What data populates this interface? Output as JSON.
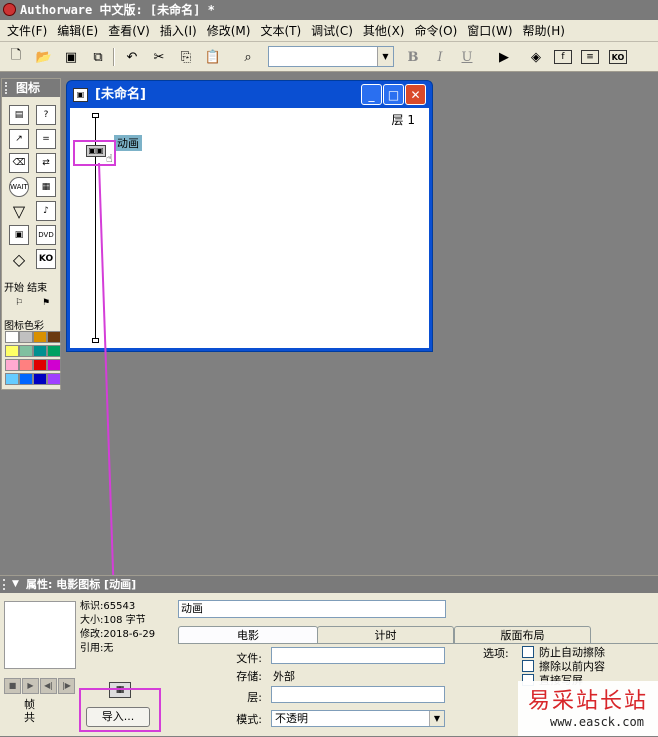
{
  "app": {
    "title": "Authorware 中文版: [未命名] *"
  },
  "menu": [
    "文件(F)",
    "编辑(E)",
    "查看(V)",
    "插入(I)",
    "修改(M)",
    "文本(T)",
    "调试(C)",
    "其他(X)",
    "命令(O)",
    "窗口(W)",
    "帮助(H)"
  ],
  "toolbar": {
    "bold": "B",
    "italic": "I",
    "underline": "U",
    "font_combo": ""
  },
  "palette": {
    "title": "图标",
    "start_end_label": "开始 结束",
    "color_label": "图标色彩",
    "colors": [
      "#ffffff",
      "#c0c0c0",
      "#d89000",
      "#6b3a10",
      "#ffff66",
      "#80c0a0",
      "#009090",
      "#00a060",
      "#ffaad0",
      "#ff8080",
      "#e00000",
      "#d000d0",
      "#66ccff",
      "#0066ff",
      "#0000c0",
      "#a040ff"
    ]
  },
  "flow_window": {
    "title": "[未命名]",
    "layer": "层 1",
    "icon_label": "动画"
  },
  "props": {
    "header": "属性: 电影图标 [动画]",
    "info": {
      "id": "标识:65543",
      "size": "大小:108 字节",
      "modified": "修改:2018-6-29",
      "ref": "引用:无"
    },
    "frame_label": "帧",
    "total_label": "共",
    "import_button": "导入...",
    "name_value": "动画",
    "tabs": [
      "电影",
      "计时",
      "版面布局"
    ],
    "fields": {
      "file_label": "文件:",
      "storage_label": "存储:",
      "storage_value": "外部",
      "layer_label": "层:",
      "mode_label": "模式:",
      "mode_value": "不透明"
    },
    "options_label": "选项:",
    "options": [
      "防止自动擦除",
      "擦除以前内容",
      "直接写屏"
    ]
  },
  "watermark": {
    "brand": "易采站长站",
    "url": "www.easck.com"
  }
}
